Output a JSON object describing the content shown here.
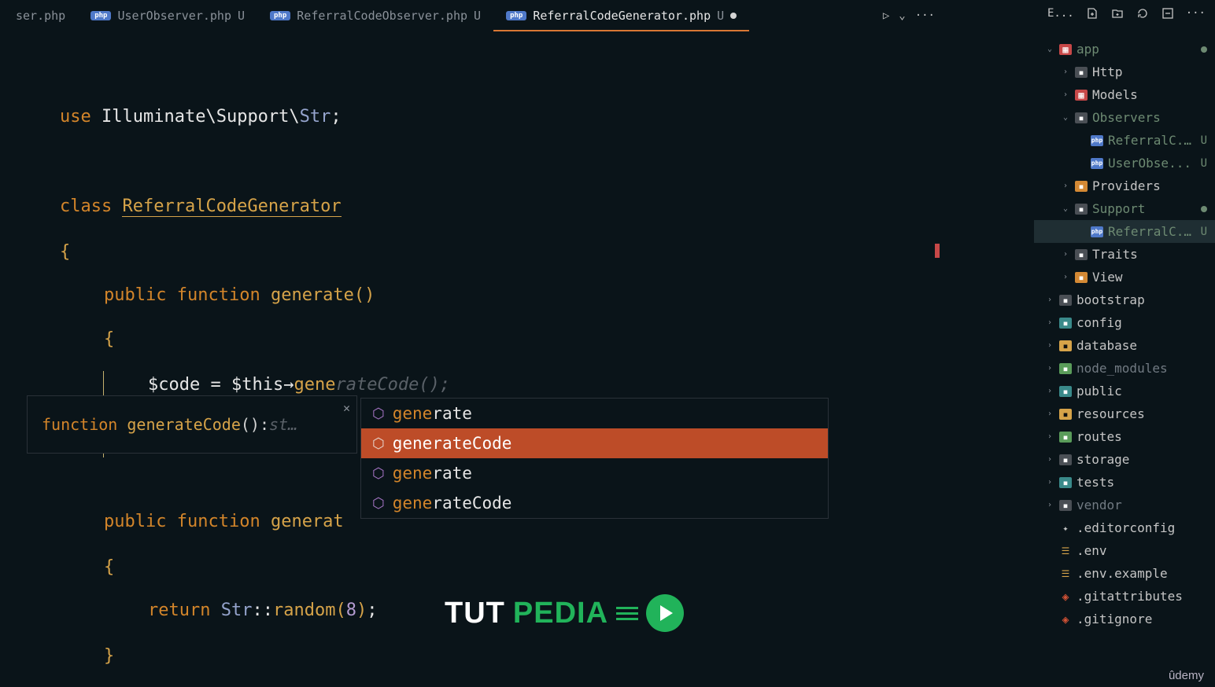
{
  "tabs": [
    {
      "label": "ser.php",
      "status": "",
      "icon": false
    },
    {
      "label": "UserObserver.php",
      "status": "U",
      "icon": true
    },
    {
      "label": "ReferralCodeObserver.php",
      "status": "U",
      "icon": true
    },
    {
      "label": "ReferralCodeGenerator.php",
      "status": "●",
      "icon": true,
      "active": true,
      "sub": "U"
    }
  ],
  "topbar": {
    "run": "▷",
    "chev": "⌄",
    "more": "···",
    "expl": "E...",
    "new": "+",
    "layout": "☐",
    "refresh": "↻",
    "split": "☐",
    "dots": "···"
  },
  "code": {
    "l1": {
      "use": "use",
      "ns1": "Illuminate",
      "sep": "\\",
      "ns2": "Support",
      "cls": "Str",
      "semi": ";"
    },
    "l2": {
      "kw": "class",
      "name": "ReferralCodeGenerator"
    },
    "l3": "{",
    "l4": {
      "pub": "public",
      "fn": "function",
      "method": "generate",
      "paren": "()"
    },
    "l5": "{",
    "l6": {
      "var": "$code",
      "eq": "=",
      "this": "$this",
      "arr": "→",
      "call": "gene",
      "ghost": "rateCode()",
      "semi": ";"
    },
    "l7": {
      "pub": "public",
      "fn": "function",
      "method": "generat"
    },
    "l8": "{",
    "l9": {
      "ret": "return",
      "cls": "Str",
      "dcol": "::",
      "call": "random",
      "open": "(",
      "num": "8",
      "close": ")",
      "semi": ";"
    },
    "l10": "}"
  },
  "hint": {
    "kw": "function",
    "name": "generateCode",
    "paren": "()",
    "colon": ": ",
    "type": "st…"
  },
  "ac": [
    {
      "match": "gene",
      "rest": "rate"
    },
    {
      "match": "gene",
      "rest": "rateCode",
      "sel": true
    },
    {
      "match": "gene",
      "rest": "rate"
    },
    {
      "match": "gene",
      "rest": "rateCode"
    }
  ],
  "explorer": [
    {
      "depth": 0,
      "arrow": "v",
      "icon": "ic-red",
      "iset": "▦",
      "label": "app",
      "cls": "fg-green",
      "dot": true
    },
    {
      "depth": 1,
      "arrow": ">",
      "icon": "ic-grey",
      "iset": "▪",
      "label": "Http"
    },
    {
      "depth": 1,
      "arrow": ">",
      "icon": "ic-red",
      "iset": "▦",
      "label": "Models"
    },
    {
      "depth": 1,
      "arrow": "v",
      "icon": "ic-grey",
      "iset": "▪",
      "label": "Observers",
      "cls": "fg-green"
    },
    {
      "depth": 2,
      "arrow": "",
      "icon": "ic-blue",
      "iset": "php",
      "label": "ReferralC...",
      "status": "U",
      "cls": "fg-green"
    },
    {
      "depth": 2,
      "arrow": "",
      "icon": "ic-blue",
      "iset": "php",
      "label": "UserObse...",
      "status": "U",
      "cls": "fg-green"
    },
    {
      "depth": 1,
      "arrow": ">",
      "icon": "ic-orange",
      "iset": "▪",
      "label": "Providers"
    },
    {
      "depth": 1,
      "arrow": "v",
      "icon": "ic-grey",
      "iset": "▪",
      "label": "Support",
      "cls": "fg-green",
      "dot": true
    },
    {
      "depth": 2,
      "arrow": "",
      "icon": "ic-blue",
      "iset": "php",
      "label": "ReferralC...",
      "status": "U",
      "cls": "fg-green",
      "sel": true
    },
    {
      "depth": 1,
      "arrow": ">",
      "icon": "ic-grey",
      "iset": "▪",
      "label": "Traits"
    },
    {
      "depth": 1,
      "arrow": ">",
      "icon": "ic-orange",
      "iset": "▪",
      "label": "View"
    },
    {
      "depth": 0,
      "arrow": ">",
      "icon": "ic-grey",
      "iset": "▪",
      "label": "bootstrap"
    },
    {
      "depth": 0,
      "arrow": ">",
      "icon": "ic-teal",
      "iset": "▪",
      "label": "config"
    },
    {
      "depth": 0,
      "arrow": ">",
      "icon": "ic-yellow",
      "iset": "▪",
      "label": "database"
    },
    {
      "depth": 0,
      "arrow": ">",
      "icon": "ic-green",
      "iset": "▪",
      "label": "node_modules",
      "cls": "fg-dim"
    },
    {
      "depth": 0,
      "arrow": ">",
      "icon": "ic-teal",
      "iset": "▪",
      "label": "public"
    },
    {
      "depth": 0,
      "arrow": ">",
      "icon": "ic-yellow",
      "iset": "▪",
      "label": "resources"
    },
    {
      "depth": 0,
      "arrow": ">",
      "icon": "ic-green",
      "iset": "▪",
      "label": "routes"
    },
    {
      "depth": 0,
      "arrow": ">",
      "icon": "ic-grey",
      "iset": "▪",
      "label": "storage"
    },
    {
      "depth": 0,
      "arrow": ">",
      "icon": "ic-teal",
      "iset": "▪",
      "label": "tests"
    },
    {
      "depth": 0,
      "arrow": ">",
      "icon": "ic-grey",
      "iset": "▪",
      "label": "vendor",
      "cls": "fg-dim"
    },
    {
      "depth": 0,
      "arrow": "",
      "icon": "ic-gear",
      "iset": "✦",
      "label": ".editorconfig"
    },
    {
      "depth": 0,
      "arrow": "",
      "icon": "ic-tune",
      "iset": "☰",
      "label": ".env"
    },
    {
      "depth": 0,
      "arrow": "",
      "icon": "ic-tune",
      "iset": "☰",
      "label": ".env.example"
    },
    {
      "depth": 0,
      "arrow": "",
      "icon": "ic-git",
      "iset": "◈",
      "label": ".gitattributes"
    },
    {
      "depth": 0,
      "arrow": "",
      "icon": "ic-git",
      "iset": "◈",
      "label": ".gitignore"
    }
  ],
  "watermark": {
    "tut": "TUT",
    "pedia": "PEDIA"
  },
  "udemy": "ûdemy"
}
